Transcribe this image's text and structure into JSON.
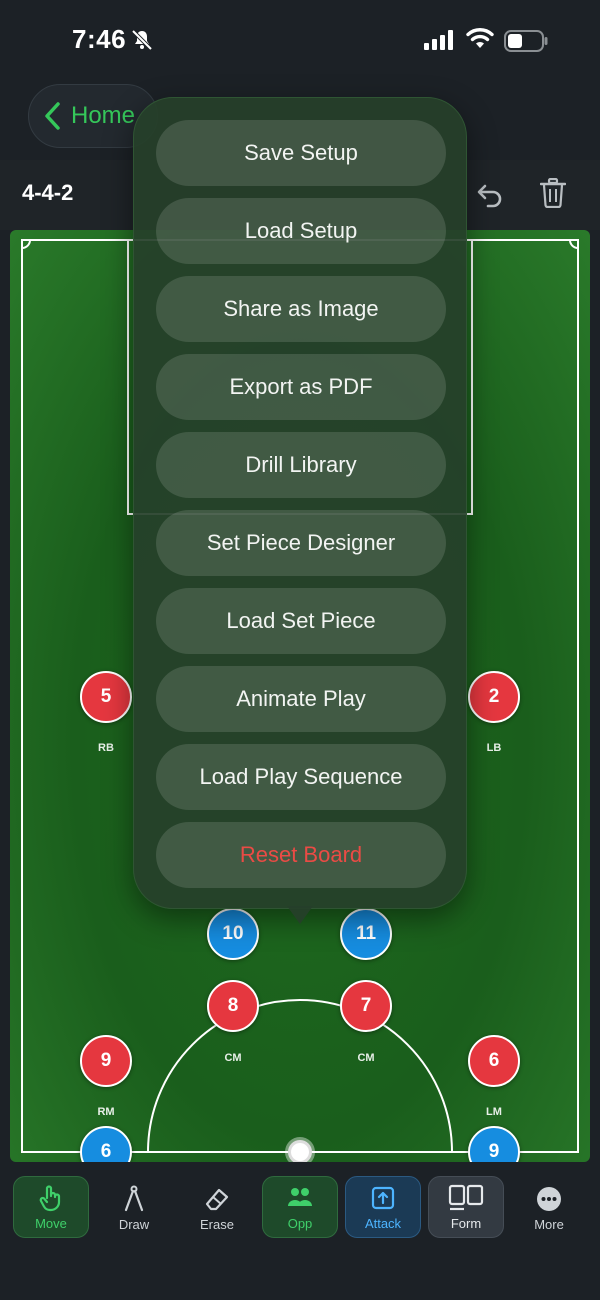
{
  "status_bar": {
    "time": "7:46"
  },
  "header": {
    "back_label": "Home"
  },
  "toolbar": {
    "formation": "4-4-2"
  },
  "menu": {
    "items": [
      {
        "label": "Save Setup",
        "style": "normal"
      },
      {
        "label": "Load Setup",
        "style": "normal"
      },
      {
        "label": "Share as Image",
        "style": "normal"
      },
      {
        "label": "Export as PDF",
        "style": "normal"
      },
      {
        "label": "Drill Library",
        "style": "normal"
      },
      {
        "label": "Set Piece Designer",
        "style": "normal"
      },
      {
        "label": "Load Set Piece",
        "style": "normal"
      },
      {
        "label": "Animate Play",
        "style": "normal"
      },
      {
        "label": "Load Play Sequence",
        "style": "normal"
      },
      {
        "label": "Reset Board",
        "style": "danger"
      }
    ]
  },
  "players": {
    "p5": {
      "number": "5",
      "position": "RB",
      "team": "red"
    },
    "p2": {
      "number": "2",
      "position": "LB",
      "team": "red"
    },
    "p10": {
      "number": "10",
      "team": "blue"
    },
    "p11": {
      "number": "11",
      "team": "blue"
    },
    "p8": {
      "number": "8",
      "position": "CM",
      "team": "red"
    },
    "p7": {
      "number": "7",
      "position": "CM",
      "team": "red"
    },
    "p9r": {
      "number": "9",
      "position": "RM",
      "team": "red"
    },
    "p6r": {
      "number": "6",
      "position": "LM",
      "team": "red"
    },
    "p6b": {
      "number": "6",
      "team": "blue"
    },
    "p9b": {
      "number": "9",
      "team": "blue"
    }
  },
  "bottom_tabs": {
    "move": "Move",
    "draw": "Draw",
    "erase": "Erase",
    "opp": "Opp",
    "attack": "Attack",
    "form": "Form",
    "more": "More"
  },
  "colors": {
    "accent_green": "#35c75a",
    "danger_red": "#ea4b45",
    "team_red": "#e5373f",
    "team_blue": "#168de0",
    "pitch": "#1e6a1e"
  }
}
